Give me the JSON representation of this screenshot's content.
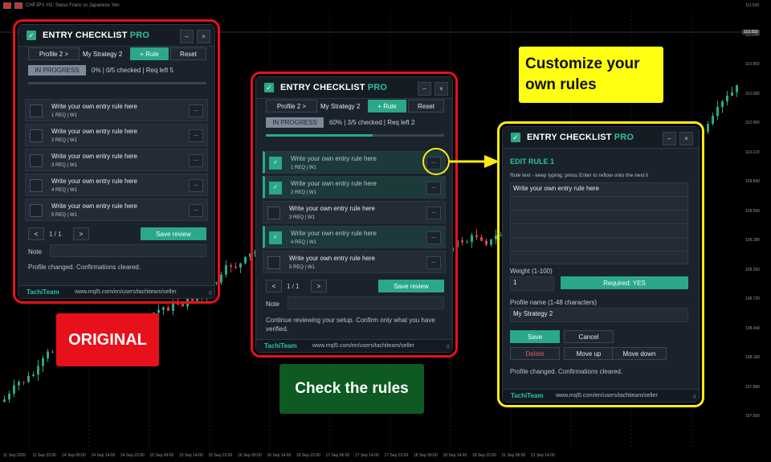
{
  "chart": {
    "symbol_line": "CHFJPY, H1: Swiss Franc vs Japanese Yen",
    "price_labels": [
      "111.520",
      "111.240",
      "110.960",
      "110.680",
      "110.400",
      "110.120",
      "109.840",
      "109.560",
      "109.280",
      "109.000",
      "108.720",
      "108.440",
      "108.160",
      "107.880",
      "107.600"
    ],
    "current_price": "110.933",
    "time_labels": [
      "11 Sep 2020",
      "11 Sep 22:00",
      "14 Sep 06:00",
      "14 Sep 14:00",
      "14 Sep 22:00",
      "15 Sep 06:00",
      "15 Sep 14:00",
      "15 Sep 22:00",
      "16 Sep 06:00",
      "16 Sep 14:00",
      "16 Sep 22:00",
      "17 Sep 06:00",
      "17 Sep 14:00",
      "17 Sep 22:00",
      "18 Sep 06:00",
      "18 Sep 14:00",
      "18 Sep 22:00",
      "21 Sep 06:00",
      "21 Sep 14:00"
    ],
    "colors": {
      "bull": "#2aa889",
      "bear": "#e0434b",
      "grid": "#151a20"
    }
  },
  "common": {
    "app_title": "ENTRY CHECKLIST",
    "app_title_accent": "PRO",
    "minimize": "–",
    "close": "×",
    "brand": "TachiTeam",
    "url": "www.mql5.com/en/users/tachiteam/seller",
    "grip": "⠿",
    "check_glyph": "✓",
    "dots": "..."
  },
  "original": {
    "profile_btn": "Profile 2 >",
    "strategy": "My Strategy 2",
    "add_rule": "+ Rule",
    "reset": "Reset",
    "status": "IN PROGRESS",
    "summary": "0%  |  0/5 checked  |  Req left 5",
    "progress": 0.0,
    "rules": [
      {
        "text": "Write your own entry rule here",
        "meta": "1  REQ  |  W1",
        "checked": false
      },
      {
        "text": "Write your own entry rule here",
        "meta": "2  REQ  |  W1",
        "checked": false
      },
      {
        "text": "Write your own entry rule here",
        "meta": "3  REQ  |  W1",
        "checked": false
      },
      {
        "text": "Write your own entry rule here",
        "meta": "4  REQ  |  W1",
        "checked": false
      },
      {
        "text": "Write your own entry rule here",
        "meta": "5  REQ  |  W1",
        "checked": false
      }
    ],
    "prev": "<",
    "page": "1 / 1",
    "next": ">",
    "save_review": "Save review",
    "note_label": "Note",
    "message": "Profile changed. Confirmations cleared."
  },
  "check": {
    "profile_btn": "Profile 2 >",
    "strategy": "My Strategy 2",
    "add_rule": "+ Rule",
    "reset": "Reset",
    "status": "IN PROGRESS",
    "summary": "60%  |  3/5 checked  |  Req left 2",
    "progress": 0.6,
    "rules": [
      {
        "text": "Write your own entry rule here",
        "meta": "1  REQ  |  W1",
        "checked": true
      },
      {
        "text": "Write your own entry rule here",
        "meta": "2  REQ  |  W1",
        "checked": true
      },
      {
        "text": "Write your own entry rule here",
        "meta": "3  REQ  |  W1",
        "checked": false
      },
      {
        "text": "Write your own entry rule here",
        "meta": "4  REQ  |  W1",
        "checked": true
      },
      {
        "text": "Write your own entry rule here",
        "meta": "5  REQ  |  W1",
        "checked": false
      }
    ],
    "prev": "<",
    "page": "1 / 1",
    "next": ">",
    "save_review": "Save review",
    "note_label": "Note",
    "message": "Continue reviewing your setup. Confirm only what you have verified."
  },
  "editor": {
    "heading": "EDIT RULE 1",
    "hint": "Rule text - keep typing; press Enter to reflow onto the next li",
    "rule_text": "Write your own entry rule here",
    "weight_label": "Weight (1-100)",
    "weight_value": "1",
    "required_btn": "Required: YES",
    "profile_label": "Profile name (1-48 characters)",
    "profile_value": "My Strategy 2",
    "save": "Save",
    "cancel": "Cancel",
    "delete": "Delete",
    "move_up": "Move up",
    "move_down": "Move down",
    "message": "Profile changed. Confirmations cleared."
  },
  "callouts": {
    "original": "ORIGINAL",
    "check": "Check the rules",
    "customize": "Customize your own rules"
  }
}
